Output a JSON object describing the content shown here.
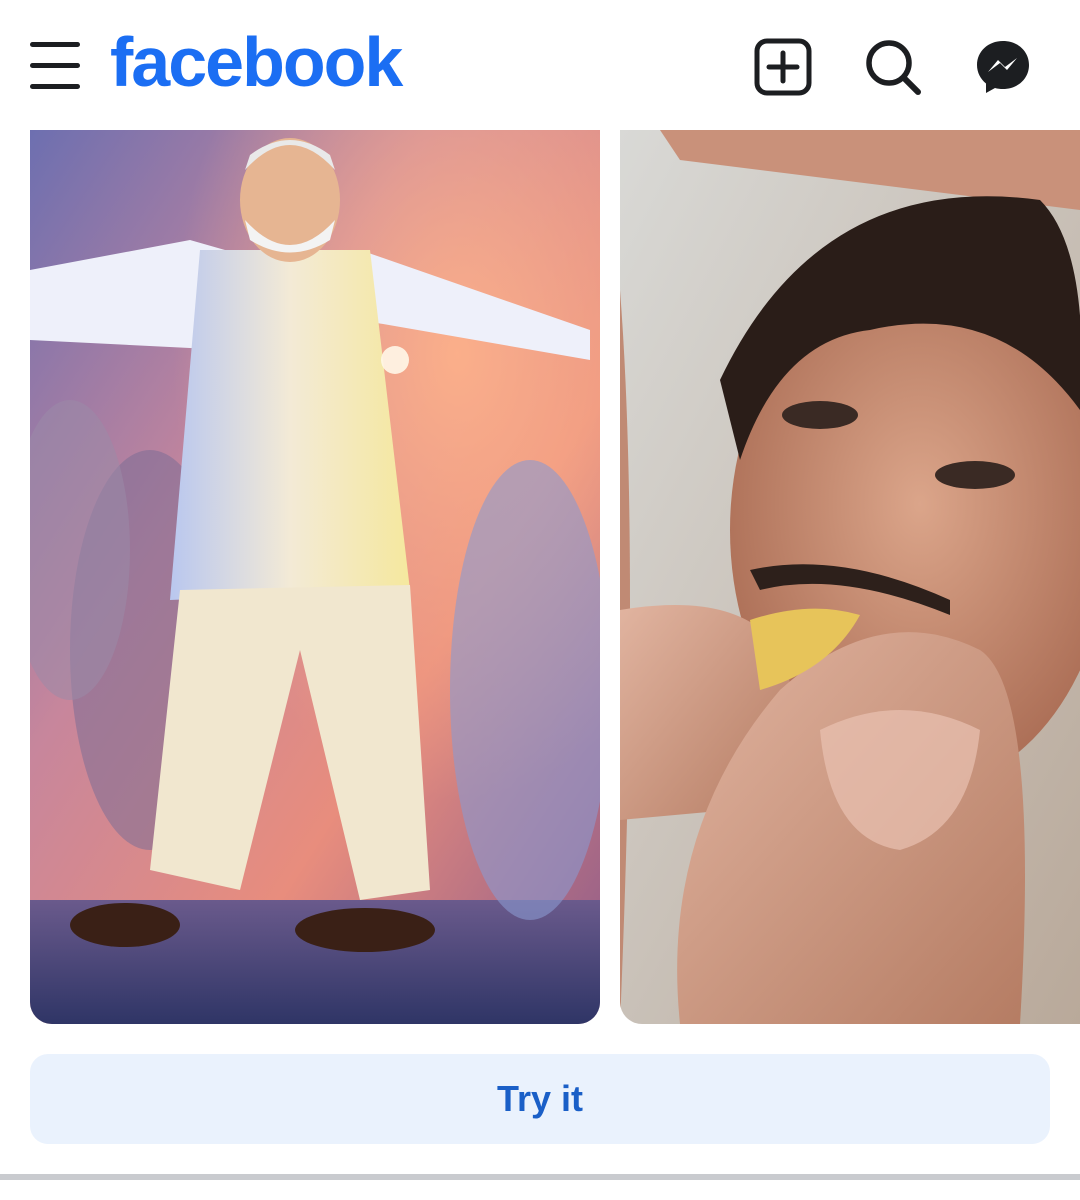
{
  "header": {
    "logo_text": "facebook",
    "icons": [
      "menu-icon",
      "plus-square-icon",
      "search-icon",
      "messenger-icon"
    ]
  },
  "cards": [
    {
      "subject": "dancing-man-in-white-kurta"
    },
    {
      "subject": "man-eating-from-giant-fingers"
    }
  ],
  "action": {
    "try_label": "Try it"
  },
  "colors": {
    "brand": "#1b6ef3",
    "button_bg": "#eaf2fd",
    "button_text": "#1a5fc7",
    "icon": "#1c1e21"
  }
}
